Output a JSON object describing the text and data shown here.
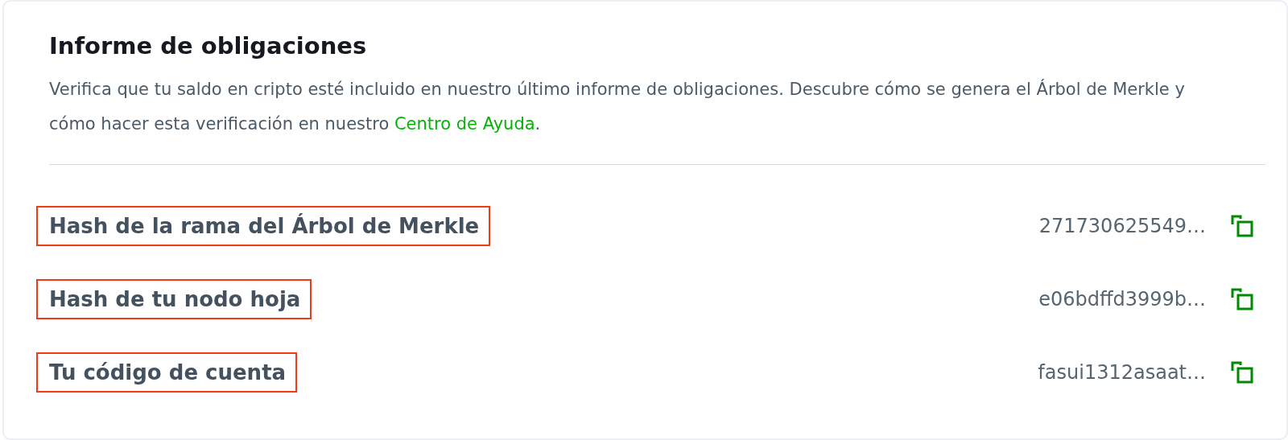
{
  "title": "Informe de obligaciones",
  "description": {
    "text": "Verifica que tu saldo en cripto esté incluido en nuestro último informe de obligaciones. Descubre cómo se genera el Árbol de Merkle y cómo hacer esta verificación en nuestro",
    "link": "Centro de Ayuda",
    "after": "."
  },
  "rows": [
    {
      "label": "Hash de la rama del Árbol de Merkle",
      "value": "271730625549…",
      "highlighted": true
    },
    {
      "label": "Hash de tu nodo hoja",
      "value": "e06bdffd3999b…",
      "highlighted": true
    },
    {
      "label": "Tu código de cuenta",
      "value": "fasui1312asaat…",
      "highlighted": true
    }
  ]
}
